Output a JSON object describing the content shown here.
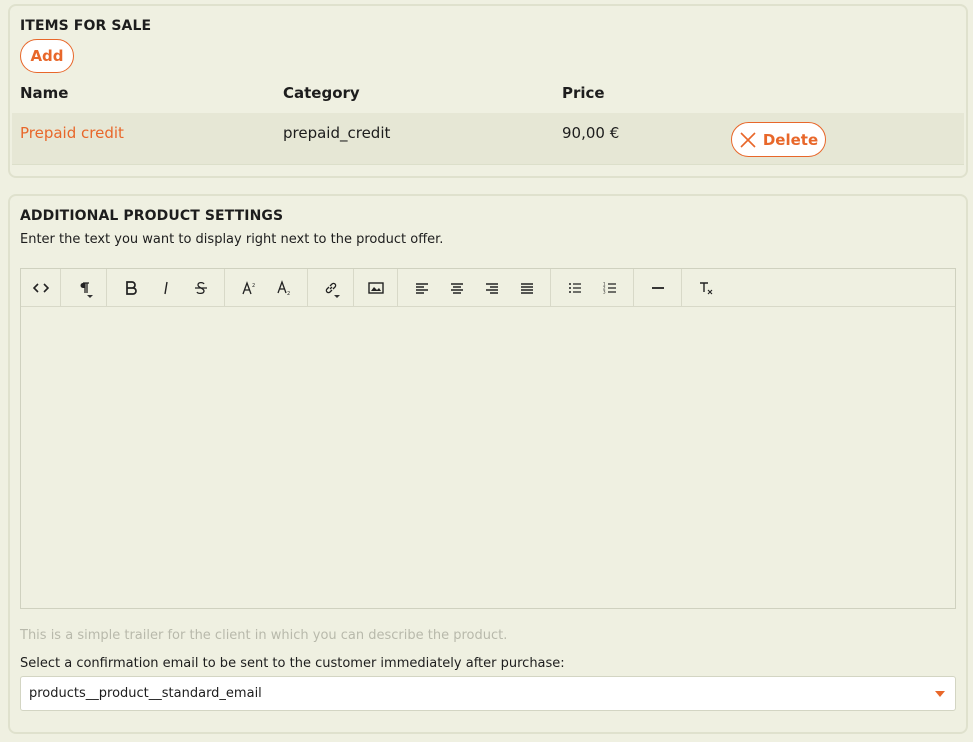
{
  "items_section": {
    "title": "ITEMS FOR SALE",
    "add_label": "Add",
    "columns": [
      "Name",
      "Category",
      "Price"
    ],
    "rows": [
      {
        "name": "Prepaid credit",
        "category": "prepaid_credit",
        "price": "90,00 €",
        "delete_label": "Delete"
      }
    ]
  },
  "settings_section": {
    "title": "ADDITIONAL PRODUCT SETTINGS",
    "description": "Enter the text you want to display right next to the product offer.",
    "editor_toolbar": [
      [
        "code-view-icon"
      ],
      [
        "paragraph-format-icon"
      ],
      [
        "bold-icon",
        "italic-icon",
        "strikethrough-icon"
      ],
      [
        "superscript-icon",
        "subscript-icon"
      ],
      [
        "insert-link-icon"
      ],
      [
        "insert-image-icon"
      ],
      [
        "align-left-icon",
        "align-center-icon",
        "align-right-icon",
        "align-justify-icon"
      ],
      [
        "unordered-list-icon",
        "ordered-list-icon"
      ],
      [
        "horizontal-line-icon"
      ],
      [
        "clear-formatting-icon"
      ]
    ],
    "editor_content": "",
    "hint": "This is a simple trailer for the client in which you can describe the product.",
    "email_select_label": "Select a confirmation email to be sent to the customer immediately after purchase:",
    "email_select_value": "products__product__standard_email"
  },
  "colors": {
    "accent": "#e8672a",
    "background": "#eff0e1",
    "row_background": "#e6e7d5"
  }
}
